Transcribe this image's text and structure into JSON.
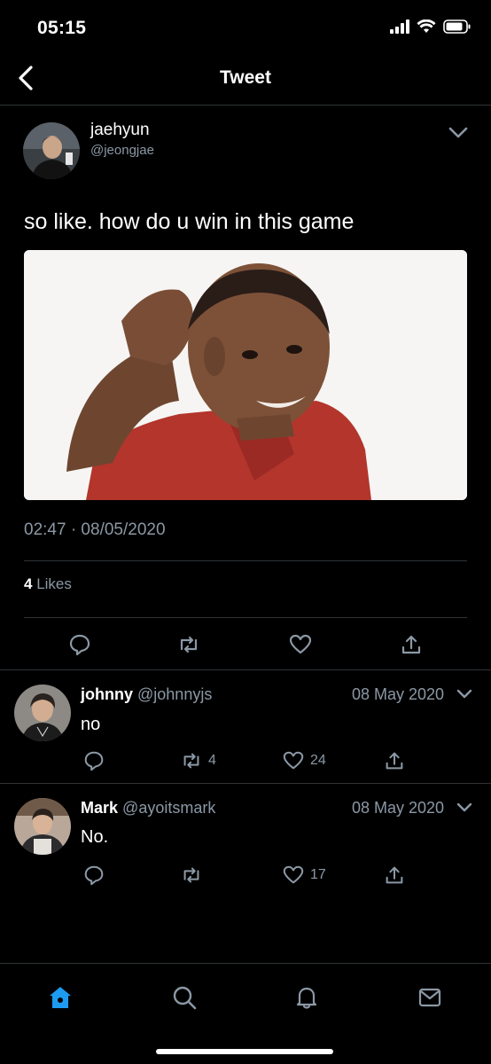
{
  "status_bar": {
    "time": "05:15"
  },
  "nav": {
    "title": "Tweet"
  },
  "tweet": {
    "author_name": "jaehyun",
    "author_handle": "@jeongjae",
    "text": "so like. how do u win in this game",
    "timestamp": "02:47 · 08/05/2020",
    "likes_count": "4",
    "likes_label": "Likes"
  },
  "replies": [
    {
      "name": "johnny",
      "handle": "@johnnyjs",
      "date": "08 May 2020",
      "text": "no",
      "retweets": "4",
      "likes": "24"
    },
    {
      "name": "Mark",
      "handle": "@ayoitsmark",
      "date": "08 May 2020",
      "text": "No.",
      "retweets": "",
      "likes": "17"
    }
  ],
  "colors": {
    "background": "#000000",
    "secondary_text": "#8b98a5",
    "divider": "#2f3336",
    "accent": "#1d9bf0"
  },
  "icons": {
    "back": "chevron-left-icon",
    "more": "chevron-down-icon",
    "reply": "speech-bubble-icon",
    "retweet": "retweet-icon",
    "like": "heart-icon",
    "share": "share-icon",
    "home": "home-icon",
    "search": "search-icon",
    "notifications": "bell-icon",
    "messages": "envelope-icon"
  }
}
